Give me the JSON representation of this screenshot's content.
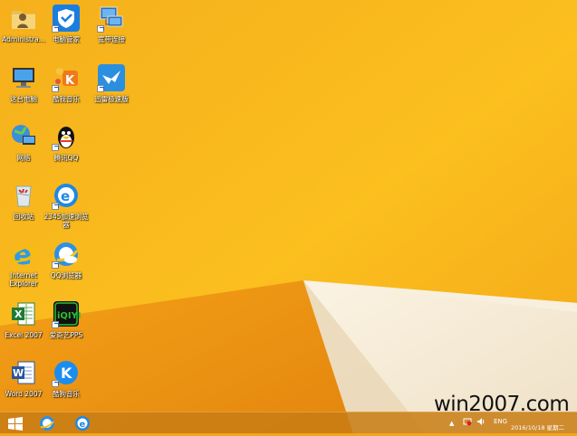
{
  "desktop": {
    "icons": [
      {
        "name": "administrator",
        "label": "Administra..."
      },
      {
        "name": "pc-manager",
        "label": "电脑管家"
      },
      {
        "name": "broadband",
        "label": "宽带连接"
      },
      {
        "name": "this-pc",
        "label": "这台电脑"
      },
      {
        "name": "kugou-music",
        "label": "酷我音乐"
      },
      {
        "name": "xunlei-speed",
        "label": "迅雷极速版"
      },
      {
        "name": "network",
        "label": "网络"
      },
      {
        "name": "tencent-qq",
        "label": "腾讯QQ"
      },
      {
        "name": "recycle-bin",
        "label": "回收站"
      },
      {
        "name": "browser-2345",
        "label": "2345加速浏览器"
      },
      {
        "name": "internet-explorer",
        "label": "Internet Explorer"
      },
      {
        "name": "qq-browser",
        "label": "QQ浏览器"
      },
      {
        "name": "excel-2007",
        "label": "Excel 2007"
      },
      {
        "name": "iqiyi-pps",
        "label": "爱奇艺PPS"
      },
      {
        "name": "word-2007",
        "label": "Word 2007"
      },
      {
        "name": "kugou-music-2",
        "label": "酷狗音乐"
      }
    ]
  },
  "watermark": "win2007.com",
  "taskbar": {
    "tray": {
      "language": "ENG"
    },
    "clock": {
      "date": "2016/10/18 星期二"
    }
  },
  "colors": {
    "wallpaper_main": "#f3a61a",
    "wallpaper_light": "#fbc51f",
    "wallpaper_dark": "#e88a10",
    "paper": "#f6ecd8"
  }
}
